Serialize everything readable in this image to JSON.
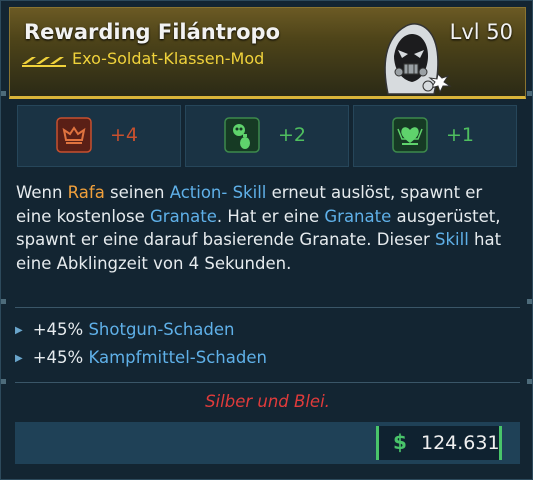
{
  "item": {
    "name": "Rewarding Filántropo",
    "level": "Lvl 50",
    "type": "Exo-Soldat-Klassen-Mod",
    "rarity_color": "#f0d23b"
  },
  "stats": [
    {
      "icon": "red-skill-icon",
      "value": "+4",
      "color": "#c8502e"
    },
    {
      "icon": "grenade-skull-icon",
      "value": "+2",
      "color": "#4fbf5f"
    },
    {
      "icon": "green-heart-icon",
      "value": "+1",
      "color": "#4fbf5f"
    }
  ],
  "description": {
    "p1": "Wenn ",
    "name": "Rafa",
    "p2": " seinen ",
    "action": "Action- Skill",
    "p3": " erneut auslöst, spawnt er eine kostenlose ",
    "granate1": "Granate",
    "p4": ". Hat er eine ",
    "granate2": "Granate",
    "p5": " ausgerüstet, spawnt er eine darauf basierende Granate. Dieser ",
    "skill": "Skill",
    "p6": " hat eine Abklingzeit von 4 Sekunden."
  },
  "bonuses": [
    {
      "amount": "+45% ",
      "label": "Shotgun-Schaden"
    },
    {
      "amount": "+45% ",
      "label": "Kampfmittel-Schaden"
    }
  ],
  "flavor_text": "Silber und Blei.",
  "price": {
    "symbol": "$",
    "value": "124.631"
  }
}
